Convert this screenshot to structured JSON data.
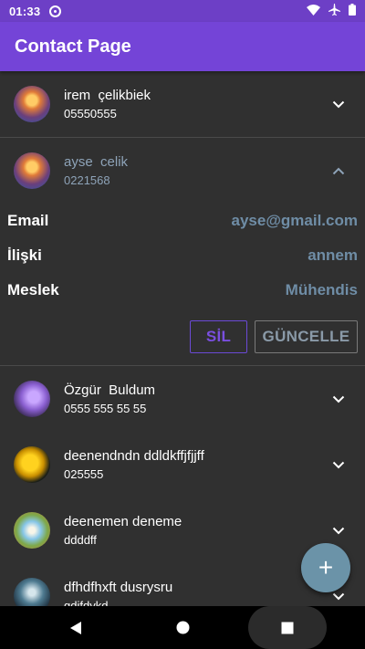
{
  "status_bar": {
    "time": "01:33",
    "icons": [
      "sync-icon",
      "wifi-icon",
      "airplane-icon",
      "battery-icon"
    ]
  },
  "app_bar": {
    "title": "Contact Page"
  },
  "contacts": [
    {
      "name": "irem  çelikbiek",
      "phone": "05550555",
      "avatar": "sunset-avatar",
      "expanded": false
    },
    {
      "name": "ayse  celik",
      "phone": "0221568",
      "avatar": "sunset-avatar",
      "expanded": true,
      "details": [
        {
          "label": "Email",
          "value": "ayse@gmail.com"
        },
        {
          "label": "İlişki",
          "value": "annem"
        },
        {
          "label": "Meslek",
          "value": "Mühendis"
        }
      ],
      "delete_label": "SİL",
      "update_label": "GÜNCELLE"
    },
    {
      "name": "Özgür  Buldum",
      "phone": "0555 555 55 55",
      "avatar": "purple-flower-avatar",
      "expanded": false
    },
    {
      "name": "deenendndn ddldkffjfjjff",
      "phone": "025555",
      "avatar": "yellow-flower-avatar",
      "expanded": false
    },
    {
      "name": "deenemen deneme",
      "phone": "ddddff",
      "avatar": "tree-avatar",
      "expanded": false
    },
    {
      "name": "dfhdfhxft dusrysru",
      "phone": "gdifdykd",
      "avatar": "lake-avatar",
      "expanded": false
    }
  ],
  "fab": {
    "label": "+"
  },
  "colors": {
    "app_bar": "#7444d7",
    "status_bar": "#6d3fc6",
    "background": "#303030",
    "accent_value": "#6f8da6",
    "fab": "#6b93a8"
  }
}
